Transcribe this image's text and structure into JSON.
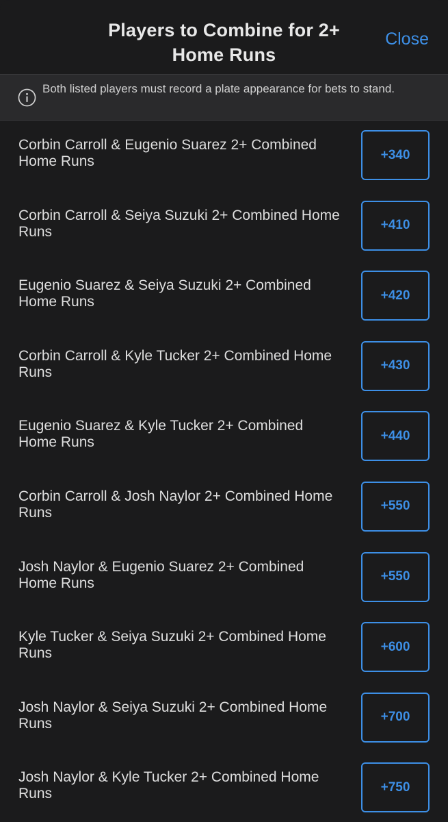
{
  "header": {
    "title": "Players to Combine for 2+ Home Runs",
    "close_label": "Close"
  },
  "notice": {
    "icon": "info-icon",
    "text": "Both listed players must record a plate appearance for bets to stand."
  },
  "colors": {
    "background": "#1b1b1c",
    "accent": "#3d8fe6",
    "notice_background": "#2a2a2c",
    "text": "#dedede"
  },
  "markets": [
    {
      "label": "Corbin Carroll & Eugenio Suarez 2+ Combined Home Runs",
      "odds": "+340"
    },
    {
      "label": "Corbin Carroll & Seiya Suzuki 2+ Combined Home Runs",
      "odds": "+410"
    },
    {
      "label": "Eugenio Suarez & Seiya Suzuki 2+ Combined Home Runs",
      "odds": "+420"
    },
    {
      "label": "Corbin Carroll & Kyle Tucker 2+ Combined Home Runs",
      "odds": "+430"
    },
    {
      "label": "Eugenio Suarez & Kyle Tucker 2+ Combined Home Runs",
      "odds": "+440"
    },
    {
      "label": "Corbin Carroll & Josh Naylor 2+ Combined Home Runs",
      "odds": "+550"
    },
    {
      "label": "Josh Naylor & Eugenio Suarez 2+ Combined Home Runs",
      "odds": "+550"
    },
    {
      "label": "Kyle Tucker & Seiya Suzuki 2+ Combined Home Runs",
      "odds": "+600"
    },
    {
      "label": "Josh Naylor & Seiya Suzuki 2+ Combined Home Runs",
      "odds": "+700"
    },
    {
      "label": "Josh Naylor & Kyle Tucker 2+ Combined Home Runs",
      "odds": "+750"
    }
  ]
}
